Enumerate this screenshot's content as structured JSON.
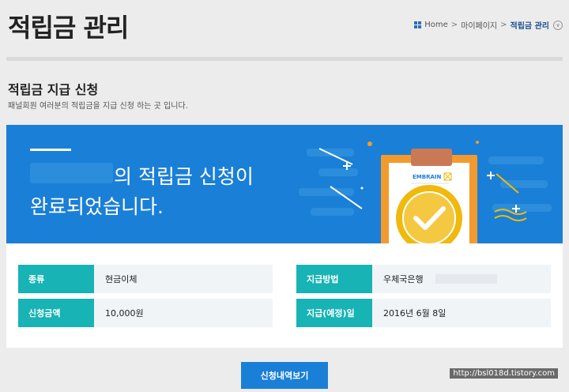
{
  "page_title": "적립금 관리",
  "breadcrumb": {
    "home": "Home",
    "mypage": "마이페이지",
    "current": "적립금 관리",
    "separator": ">"
  },
  "section": {
    "title": "적립금 지급 신청",
    "description": "패널회원 여러분의 적립금을 지급 신청 하는 곳 입니다."
  },
  "banner": {
    "line1": "의 적립금 신청이",
    "line2": "완료되었습니다.",
    "logo_text": "EMBRAIN"
  },
  "info": {
    "type_label": "종류",
    "type_value": "현금이체",
    "method_label": "지급방법",
    "method_value": "우체국은행",
    "amount_label": "신청금액",
    "amount_value": "10,000원",
    "date_label": "지급(예정)일",
    "date_value": "2016년 6월 8일"
  },
  "buttons": {
    "history": "신청내역보기"
  },
  "watermark": "http://bsl018d.tistory.com",
  "colors": {
    "banner_bg": "#1a7fd6",
    "label_bg": "#17b3b5",
    "badge": "#f0b90b",
    "clipboard": "#f29a2e"
  }
}
